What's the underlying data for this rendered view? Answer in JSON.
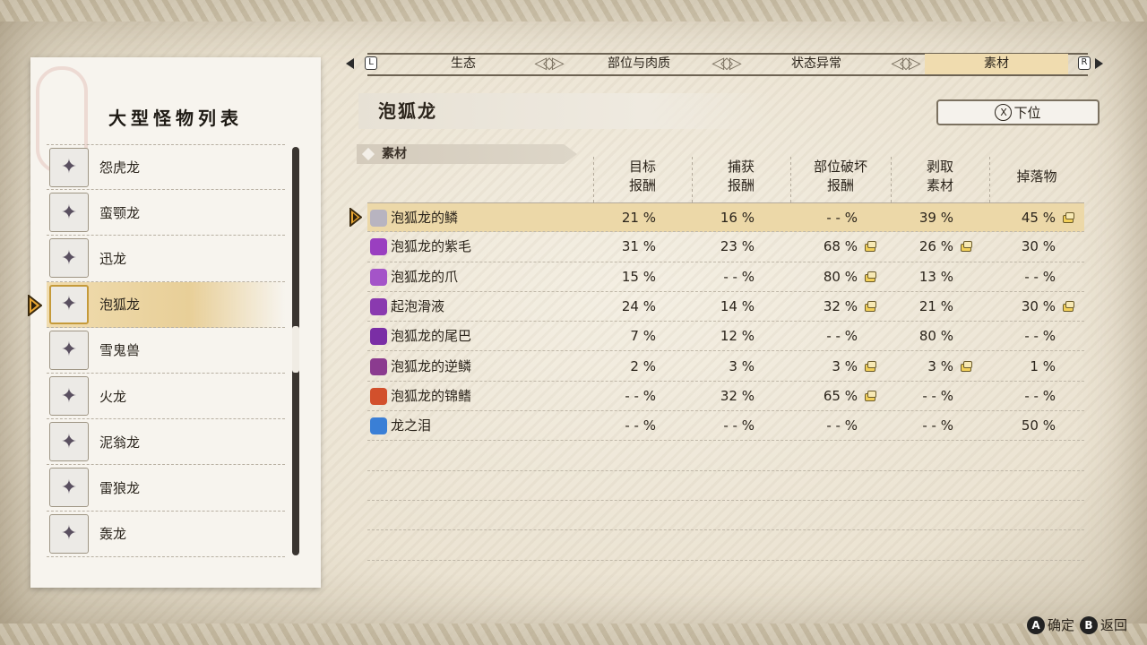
{
  "tabs": [
    {
      "label": "生态",
      "active": false
    },
    {
      "label": "部位与肉质",
      "active": false
    },
    {
      "label": "状态异常",
      "active": false
    },
    {
      "label": "素材",
      "active": true
    }
  ],
  "tab_left_key": "L",
  "tab_right_key": "R",
  "left_panel": {
    "title": "大型怪物列表",
    "selected_index": 3,
    "monsters": [
      {
        "name": "怨虎龙",
        "icon": "magnamalo-icon"
      },
      {
        "name": "蛮颚龙",
        "icon": "anjanath-icon"
      },
      {
        "name": "迅龙",
        "icon": "nargacuga-icon"
      },
      {
        "name": "泡狐龙",
        "icon": "mizutsune-icon"
      },
      {
        "name": "雪鬼兽",
        "icon": "goss-harag-icon"
      },
      {
        "name": "火龙",
        "icon": "rathalos-icon"
      },
      {
        "name": "泥翁龙",
        "icon": "almudron-icon"
      },
      {
        "name": "雷狼龙",
        "icon": "zinogre-icon"
      },
      {
        "name": "轰龙",
        "icon": "tigrex-icon"
      }
    ]
  },
  "detail": {
    "monster_name": "泡狐龙",
    "down_button": {
      "key": "X",
      "label": "下位"
    },
    "section_label": "素材",
    "columns": [
      "目标\n报酬",
      "捕获\n报酬",
      "部位破坏\n报酬",
      "剥取\n素材",
      "掉落物"
    ],
    "selected_row": 0,
    "materials": [
      {
        "name": "泡狐龙的鳞",
        "icon": "scale-icon",
        "color": "#b8b4c0",
        "values": [
          {
            "v": "21 %"
          },
          {
            "v": "16 %"
          },
          {
            "v": "- - %"
          },
          {
            "v": "39 %"
          },
          {
            "v": "45 %",
            "note": true
          }
        ]
      },
      {
        "name": "泡狐龙的紫毛",
        "icon": "fur-icon",
        "color": "#9a3fc0",
        "values": [
          {
            "v": "31 %"
          },
          {
            "v": "23 %"
          },
          {
            "v": "68 %",
            "note": true
          },
          {
            "v": "26 %",
            "note": true
          },
          {
            "v": "30 %"
          }
        ]
      },
      {
        "name": "泡狐龙的爪",
        "icon": "claw-icon",
        "color": "#a454c8",
        "values": [
          {
            "v": "15 %"
          },
          {
            "v": "- - %"
          },
          {
            "v": "80 %",
            "note": true
          },
          {
            "v": "13 %"
          },
          {
            "v": "- - %"
          }
        ]
      },
      {
        "name": "起泡滑液",
        "icon": "fluid-icon",
        "color": "#8a3aaf",
        "values": [
          {
            "v": "24 %"
          },
          {
            "v": "14 %"
          },
          {
            "v": "32 %",
            "note": true
          },
          {
            "v": "21 %"
          },
          {
            "v": "30 %",
            "note": true
          }
        ]
      },
      {
        "name": "泡狐龙的尾巴",
        "icon": "tail-icon",
        "color": "#7a2ea5",
        "values": [
          {
            "v": "7 %"
          },
          {
            "v": "12 %"
          },
          {
            "v": "- - %"
          },
          {
            "v": "80 %"
          },
          {
            "v": "- - %"
          }
        ]
      },
      {
        "name": "泡狐龙的逆鳞",
        "icon": "gem-icon",
        "color": "#8b3b8f",
        "values": [
          {
            "v": "2 %"
          },
          {
            "v": "3 %"
          },
          {
            "v": "3 %",
            "note": true
          },
          {
            "v": "3 %",
            "note": true
          },
          {
            "v": "1 %"
          }
        ]
      },
      {
        "name": "泡狐龙的锦鳍",
        "icon": "fin-icon",
        "color": "#d2502c",
        "values": [
          {
            "v": "- - %"
          },
          {
            "v": "32 %"
          },
          {
            "v": "65 %",
            "note": true
          },
          {
            "v": "- - %"
          },
          {
            "v": "- - %"
          }
        ]
      },
      {
        "name": "龙之泪",
        "icon": "tear-icon",
        "color": "#3a7fd6",
        "values": [
          {
            "v": "- - %"
          },
          {
            "v": "- - %"
          },
          {
            "v": "- - %"
          },
          {
            "v": "- - %"
          },
          {
            "v": "50 %"
          }
        ]
      }
    ]
  },
  "footer": {
    "confirm_key": "A",
    "confirm_label": "确定",
    "back_key": "B",
    "back_label": "返回"
  }
}
